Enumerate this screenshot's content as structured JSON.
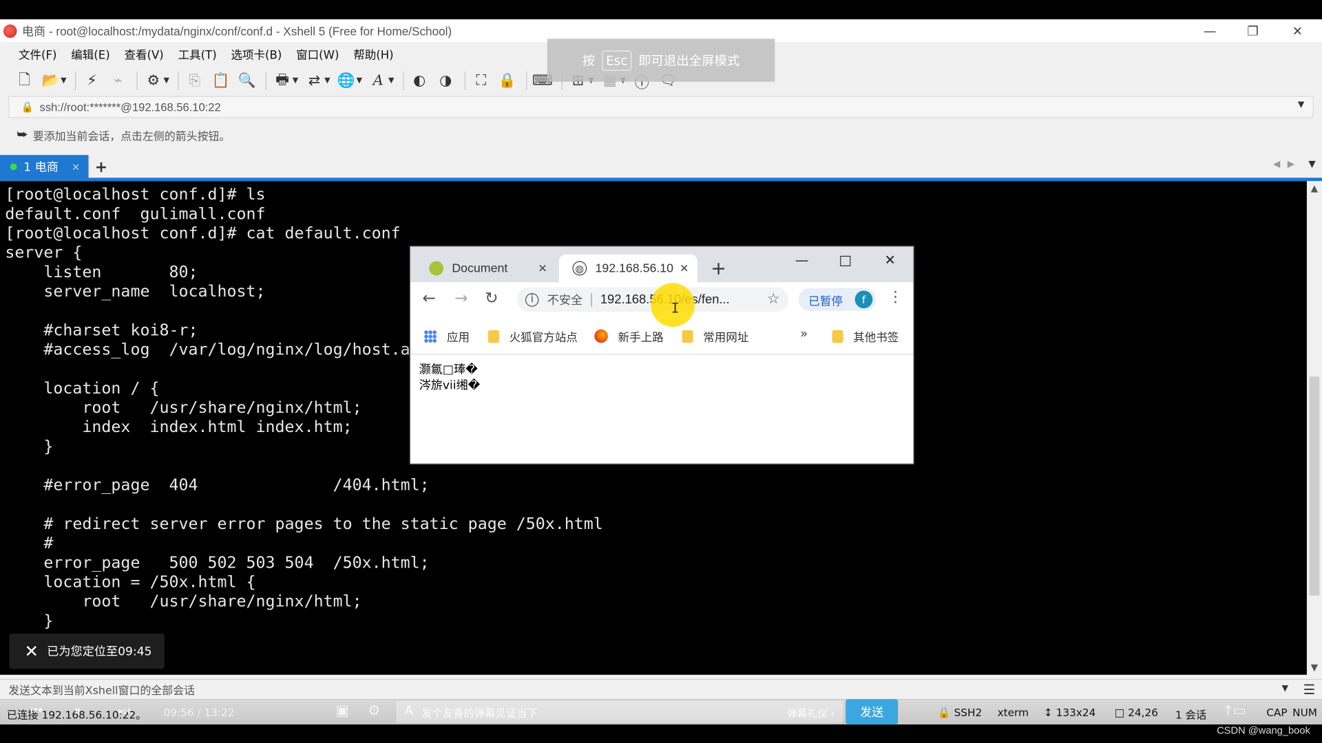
{
  "window": {
    "title": "电商 - root@localhost:/mydata/nginx/conf/conf.d - Xshell 5 (Free for Home/School)",
    "minimize": "—",
    "restore": "❐",
    "close": "✕"
  },
  "menu": [
    "文件(F)",
    "编辑(E)",
    "查看(V)",
    "工具(T)",
    "选项卡(B)",
    "窗口(W)",
    "帮助(H)"
  ],
  "fullscreen_tip": {
    "prefix": "按",
    "key": "Esc",
    "suffix": "即可退出全屏模式"
  },
  "address_bar": {
    "value": "ssh://root:*******@192.168.56.10:22"
  },
  "hint": {
    "text": "要添加当前会话，点击左侧的箭头按钮。"
  },
  "tabs": {
    "active_label": "1 电商",
    "close": "×",
    "add": "+"
  },
  "terminal": {
    "lines": [
      "[root@localhost conf.d]# ls",
      "default.conf  gulimall.conf",
      "[root@localhost conf.d]# cat default.conf",
      "server {",
      "    listen       80;",
      "    server_name  localhost;",
      "",
      "    #charset koi8-r;",
      "    #access_log  /var/log/nginx/log/host.access.log  main;",
      "",
      "    location / {",
      "        root   /usr/share/nginx/html;",
      "        index  index.html index.htm;",
      "    }",
      "",
      "    #error_page  404              /404.html;",
      "",
      "    # redirect server error pages to the static page /50x.html",
      "    #",
      "    error_page   500 502 503 504  /50x.html;",
      "    location = /50x.html {",
      "        root   /usr/share/nginx/html;",
      "    }"
    ]
  },
  "toast": {
    "text": "已为您定位至09:45"
  },
  "send_bar": {
    "text": "发送文本到当前Xshell窗口的全部会话"
  },
  "status": {
    "connection": "已连接 192.168.56.10:22。",
    "time": "09:56 / 13:22",
    "danmaku_placeholder": "发个友善的弹幕见证当下",
    "danmaku_etiquette": "弹幕礼仪 ›",
    "send_button": "发送",
    "protocol": "SSH2",
    "term": "xterm",
    "size": "133x24",
    "cursor": "24,26",
    "sessions": "1 会话",
    "cap": "CAP",
    "num": "NUM",
    "watermark": "CSDN @wang_book"
  },
  "browser": {
    "tabs": [
      {
        "label": "Document",
        "close": "✕"
      },
      {
        "label": "192.168.56.10",
        "close": "✕"
      }
    ],
    "new_tab": "+",
    "insecure_label": "不安全",
    "url": "192.168.56.10/es/fen...",
    "paused_label": "已暂停",
    "avatar_letter": "f",
    "bookmarks": [
      "应用",
      "火狐官方站点",
      "新手上路",
      "常用网址"
    ],
    "more": "»",
    "other_bookmarks": "其他书签",
    "page_lines": [
      "灏氱□琫�",
      "涔旂vii缃�"
    ]
  }
}
